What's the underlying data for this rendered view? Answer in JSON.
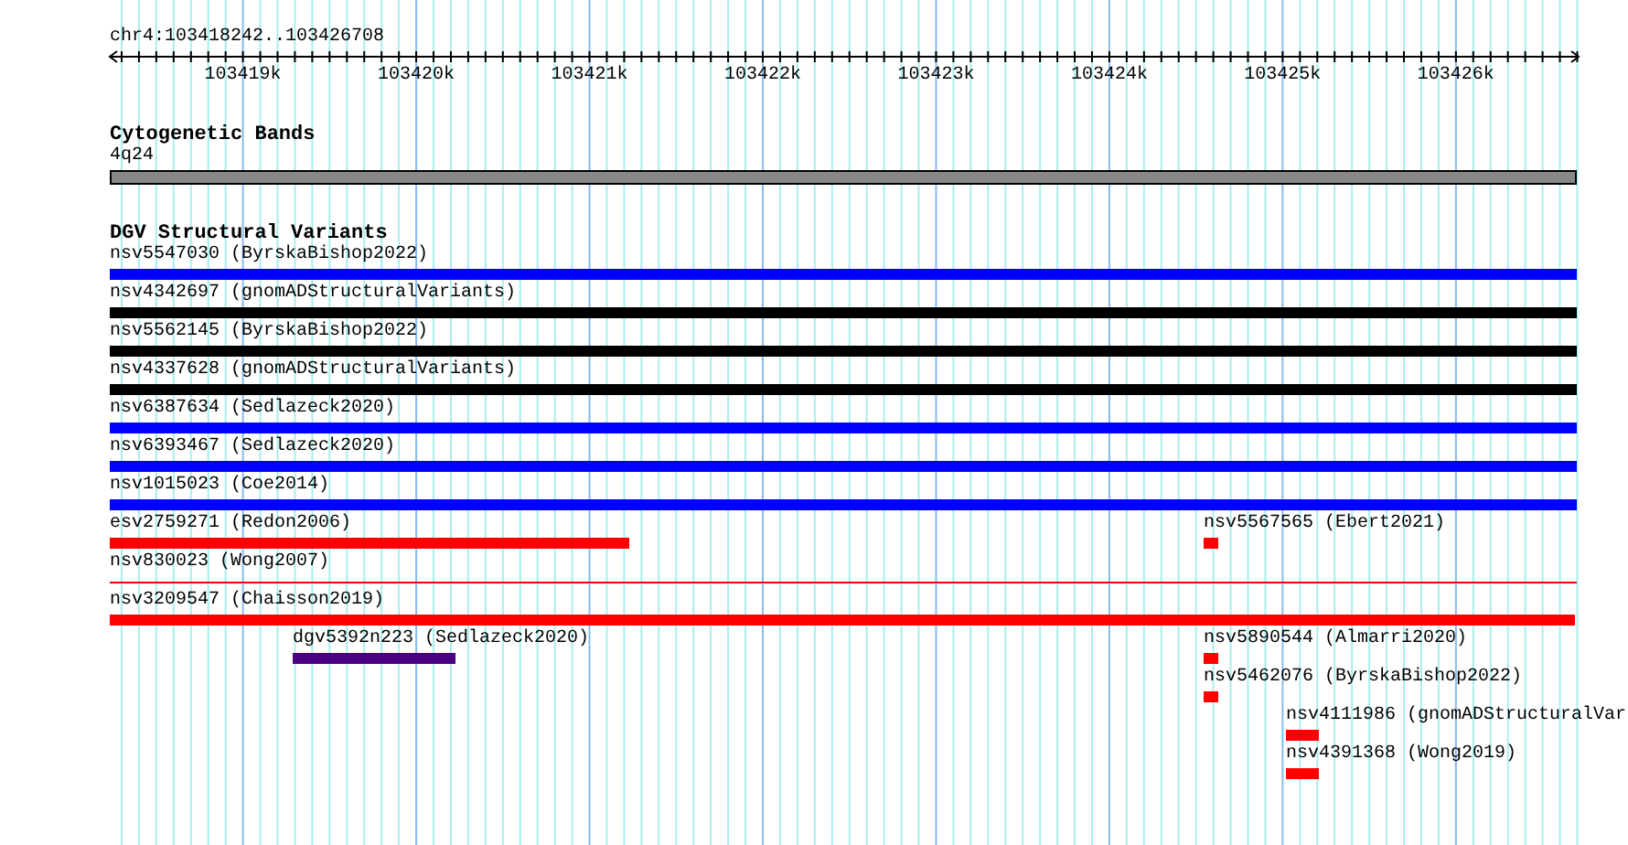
{
  "ruler": {
    "position": "chr4:103418242..103426708",
    "ticks": [
      "103419k",
      "103420k",
      "103421k",
      "103422k",
      "103423k",
      "103424k",
      "103425k",
      "103426k"
    ]
  },
  "cytogenetic_bands": {
    "title": "Cytogenetic Bands",
    "band": "4q24"
  },
  "dgv": {
    "title": "DGV Structural Variants",
    "rows": [
      {
        "features": [
          {
            "label": "nsv5547030 (ByrskaBishop2022)",
            "color": "#0000ff",
            "kind": "bar"
          }
        ]
      },
      {
        "features": [
          {
            "label": "nsv4342697 (gnomADStructuralVariants)",
            "color": "#000000",
            "kind": "bar"
          }
        ]
      },
      {
        "features": [
          {
            "label": "nsv5562145 (ByrskaBishop2022)",
            "color": "#000000",
            "kind": "bar"
          }
        ]
      },
      {
        "features": [
          {
            "label": "nsv4337628 (gnomADStructuralVariants)",
            "color": "#000000",
            "kind": "bar"
          }
        ]
      },
      {
        "features": [
          {
            "label": "nsv6387634 (Sedlazeck2020)",
            "color": "#0000ff",
            "kind": "bar"
          }
        ]
      },
      {
        "features": [
          {
            "label": "nsv6393467 (Sedlazeck2020)",
            "color": "#0000ff",
            "kind": "bar"
          }
        ]
      },
      {
        "features": [
          {
            "label": "nsv1015023 (Coe2014)",
            "color": "#0000ff",
            "kind": "bar"
          }
        ]
      },
      {
        "features": [
          {
            "label": "esv2759271 (Redon2006)",
            "color": "#ff0000",
            "kind": "bar"
          },
          {
            "label": "nsv5567565 (Ebert2021)",
            "color": "#ff0000",
            "kind": "bar"
          }
        ]
      },
      {
        "features": [
          {
            "label": "nsv830023 (Wong2007)",
            "color": "#ff0000",
            "kind": "line"
          }
        ]
      },
      {
        "features": [
          {
            "label": "nsv3209547 (Chaisson2019)",
            "color": "#ff0000",
            "kind": "bar"
          }
        ]
      },
      {
        "features": [
          {
            "label": "dgv5392n223 (Sedlazeck2020)",
            "color": "#4b0082",
            "kind": "bar"
          },
          {
            "label": "nsv5890544 (Almarri2020)",
            "color": "#ff0000",
            "kind": "bar"
          }
        ]
      },
      {
        "features": [
          {
            "label": "nsv5462076 (ByrskaBishop2022)",
            "color": "#ff0000",
            "kind": "bar"
          }
        ]
      },
      {
        "features": [
          {
            "label": "nsv4111986 (gnomADStructuralVar",
            "color": "#ff0000",
            "kind": "bar"
          }
        ]
      },
      {
        "features": [
          {
            "label": "nsv4391368 (Wong2019)",
            "color": "#ff0000",
            "kind": "bar"
          }
        ]
      }
    ]
  }
}
